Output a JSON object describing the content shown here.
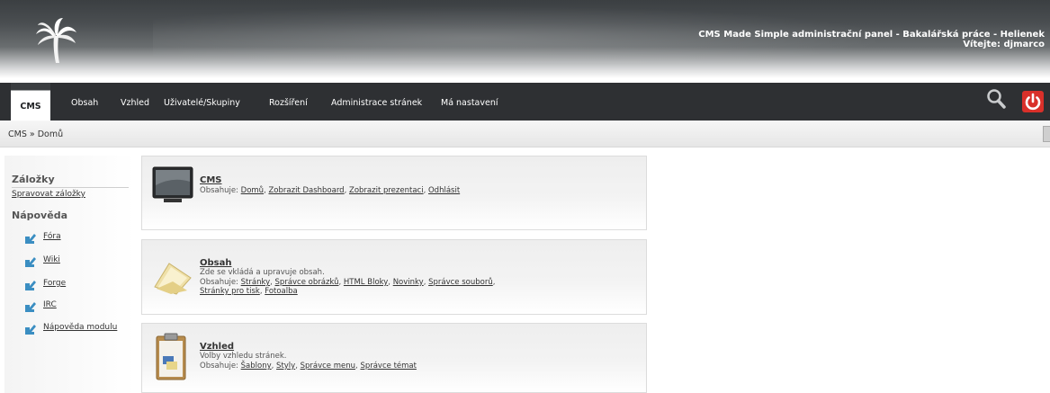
{
  "header": {
    "title": "CMS Made Simple administrační panel - Bakalářská práce - Helienek",
    "welcome": "Vítejte: djmarco",
    "logo_icon": "palm-tree-logo-icon"
  },
  "nav": {
    "items": [
      {
        "label": "CMS",
        "active": true
      },
      {
        "label": "Obsah"
      },
      {
        "label": "Vzhled"
      },
      {
        "label": "Uživatelé/Skupiny"
      },
      {
        "label": "Rozšíření"
      },
      {
        "label": "Administrace stránek"
      },
      {
        "label": "Má nastavení"
      }
    ],
    "search_icon": "magnifier-icon",
    "logout_icon": "power-icon"
  },
  "breadcrumb": "CMS » Domů",
  "sidebar": {
    "bookmarks_heading": "Záložky",
    "manage_bookmarks": "Spravovat záložky",
    "help_heading": "Nápověda",
    "help_items": [
      "Fóra",
      "Wiki",
      "Forge",
      "IRC",
      "Nápověda modulu"
    ]
  },
  "panels": [
    {
      "title": "CMS",
      "desc": "",
      "contains_label": "Obsahuje: ",
      "links": [
        "Domů",
        "Zobrazit Dashboard",
        "Zobrazit prezentaci",
        "Odhlásit"
      ],
      "icon": "monitor-icon"
    },
    {
      "title": "Obsah",
      "desc": "Zde se vkládá a upravuje obsah.",
      "contains_label": "Obsahuje: ",
      "links": [
        "Stránky",
        "Správce obrázků",
        "HTML Bloky",
        "Novinky",
        "Správce souborů",
        "Stránky pro tisk",
        "Fotoalba"
      ],
      "icon": "folder-icon"
    },
    {
      "title": "Vzhled",
      "desc": "Volby vzhledu stránek.",
      "contains_label": "Obsahuje: ",
      "links": [
        "Šablony",
        "Styly",
        "Správce menu",
        "Správce témat"
      ],
      "icon": "clipboard-icon"
    }
  ],
  "colors": {
    "nav_bg": "#2e3033",
    "logout_red": "#d9302a"
  }
}
